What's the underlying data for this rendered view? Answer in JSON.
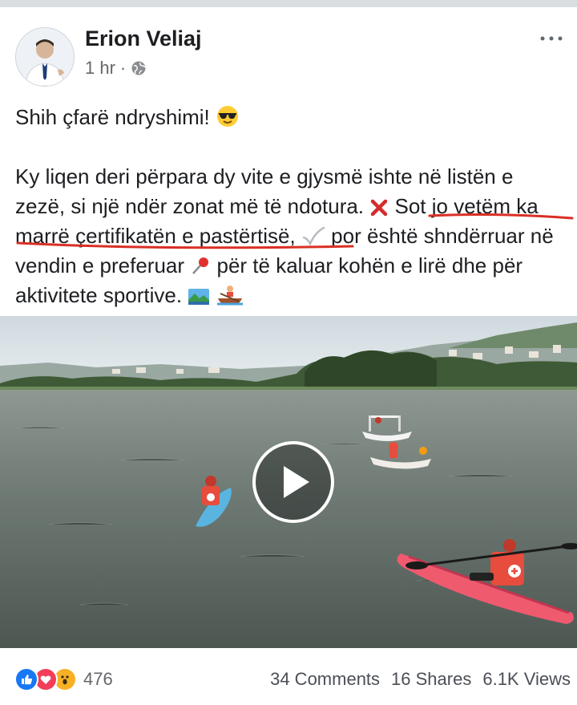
{
  "post": {
    "author": "Erion Veliaj",
    "time": "1 hr",
    "privacy_icon": "globe-icon",
    "line1": "Shih çfarë ndryshimi!",
    "p2_a": "Ky liqen deri përpara dy vite e gjysmë ishte në listën e zezë, si një ndër zonat më të ndotura.",
    "p2_b": "Sot jo vetëm ka marrë çertifikatën e pastërtisë,",
    "p2_c": "por është shndërruar në vendin e preferuar",
    "p2_d": "për të kaluar kohën e lirë dhe për aktivitete sportive."
  },
  "video": {
    "play_icon": "play-icon"
  },
  "footer": {
    "reactions_count": "476",
    "comments": "34 Comments",
    "shares": "16 Shares",
    "views": "6.1K Views"
  },
  "colors": {
    "like": "#1877f2",
    "love": "#f33e58",
    "underline": "#d93025"
  }
}
